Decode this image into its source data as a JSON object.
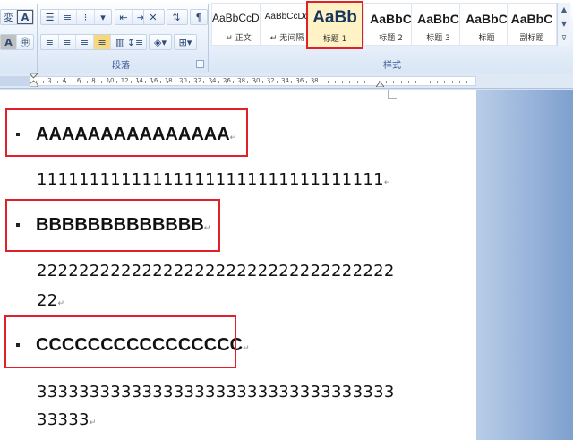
{
  "ribbon": {
    "paragraph_group_label": "段落",
    "styles_group_label": "样式",
    "styles": [
      {
        "sample": "AaBbCcDd",
        "name": "↵ 正文",
        "selected": false
      },
      {
        "sample": "AaBbCcDd",
        "name": "↵ 无间隔",
        "selected": false
      },
      {
        "sample": "AaBb",
        "name": "标题 1",
        "selected": true
      },
      {
        "sample": "AaBbC",
        "name": "标题 2",
        "selected": false
      },
      {
        "sample": "AaBbC",
        "name": "标题 3",
        "selected": false
      },
      {
        "sample": "AaBbC",
        "name": "标题",
        "selected": false
      },
      {
        "sample": "AaBbC",
        "name": "副标题",
        "selected": false
      }
    ]
  },
  "ruler": {
    "numbers": [
      "2",
      "4",
      "6",
      "8",
      "10",
      "12",
      "14",
      "16",
      "18",
      "20",
      "22",
      "24",
      "26",
      "28",
      "30",
      "32",
      "34",
      "36",
      "38"
    ]
  },
  "document": {
    "headings": [
      {
        "text": "AAAAAAAAAAAAAAA"
      },
      {
        "text": "BBBBBBBBBBBBB"
      },
      {
        "text": "CCCCCCCCCCCCCCCC"
      }
    ],
    "paragraphs": [
      {
        "lines": [
          "111111111111111111111111111111111"
        ]
      },
      {
        "lines": [
          "2222222222222222222222222222222222",
          "22"
        ]
      },
      {
        "lines": [
          "3333333333333333333333333333333333",
          "33333"
        ]
      }
    ],
    "paragraph_mark": "↵"
  }
}
